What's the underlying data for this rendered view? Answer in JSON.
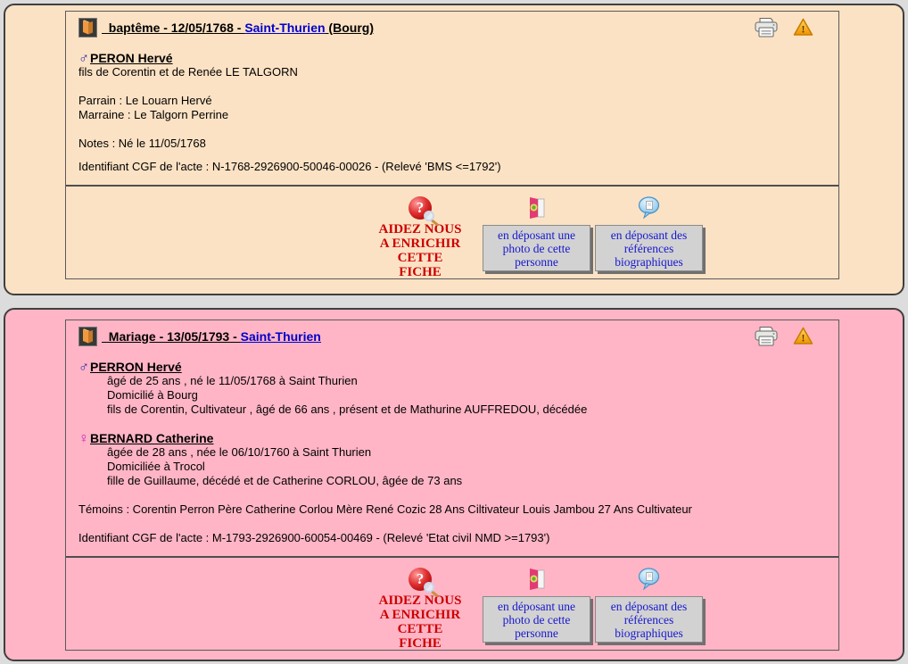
{
  "page": {
    "background_color": "#DCDCDC"
  },
  "help": {
    "question_mark": "?",
    "text": "AIDEZ NOUS\nA ENRICHIR\nCETTE FICHE",
    "photo_button": "en déposant une photo de cette personne",
    "bio_button": "en déposant des références biographiques"
  },
  "records": [
    {
      "type": "baptême",
      "card_color": "#FCE2C4",
      "title_prefix": "  baptême - 12/05/1768 - ",
      "title_place": "Saint-Thurien",
      "title_suffix": " (Bourg)",
      "person": {
        "gender_symbol": "♂",
        "name": "PERON Hervé",
        "filiation": "fils de Corentin et de Renée LE TALGORN"
      },
      "godfather": "Parrain : Le Louarn Hervé",
      "godmother": "Marraine : Le Talgorn Perrine",
      "notes": "Notes : Né le 11/05/1768",
      "act_id": "Identifiant CGF de l'acte : N-1768-2926900-50046-00026 - (Relevé 'BMS <=1792')"
    },
    {
      "type": "mariage",
      "card_color": "#FFB5C5",
      "title_prefix": "  Mariage - 13/05/1793 - ",
      "title_place": "Saint-Thurien",
      "title_suffix": "",
      "groom": {
        "gender_symbol": "♂",
        "name": "PERRON Hervé",
        "details": [
          "âgé de 25 ans , né le 11/05/1768 à Saint Thurien",
          "Domicilié à Bourg",
          "fils de Corentin, Cultivateur , âgé de 66 ans , présent et de Mathurine AUFFREDOU, décédée"
        ]
      },
      "bride": {
        "gender_symbol": "♀",
        "name": "BERNARD Catherine",
        "details": [
          "âgée de 28 ans , née le 06/10/1760 à Saint Thurien",
          "Domiciliée à Trocol",
          "fille de Guillaume, décédé et de Catherine CORLOU, âgée de 73 ans"
        ]
      },
      "witnesses": "Témoins : Corentin Perron Père Catherine Corlou Mère René Cozic 28 Ans Ciltivateur Louis Jambou 27 Ans Cultivateur",
      "act_id": "Identifiant CGF de l'acte : M-1793-2926900-60054-00469 - (Relevé 'Etat civil NMD >=1793')"
    }
  ],
  "colors": {
    "link": "#0000CC",
    "male_symbol": "#2121B2",
    "female_symbol": "#C424C4",
    "help_text": "#CC0000",
    "button_text": "#1717CE",
    "button_background": "#D2D2D2"
  }
}
